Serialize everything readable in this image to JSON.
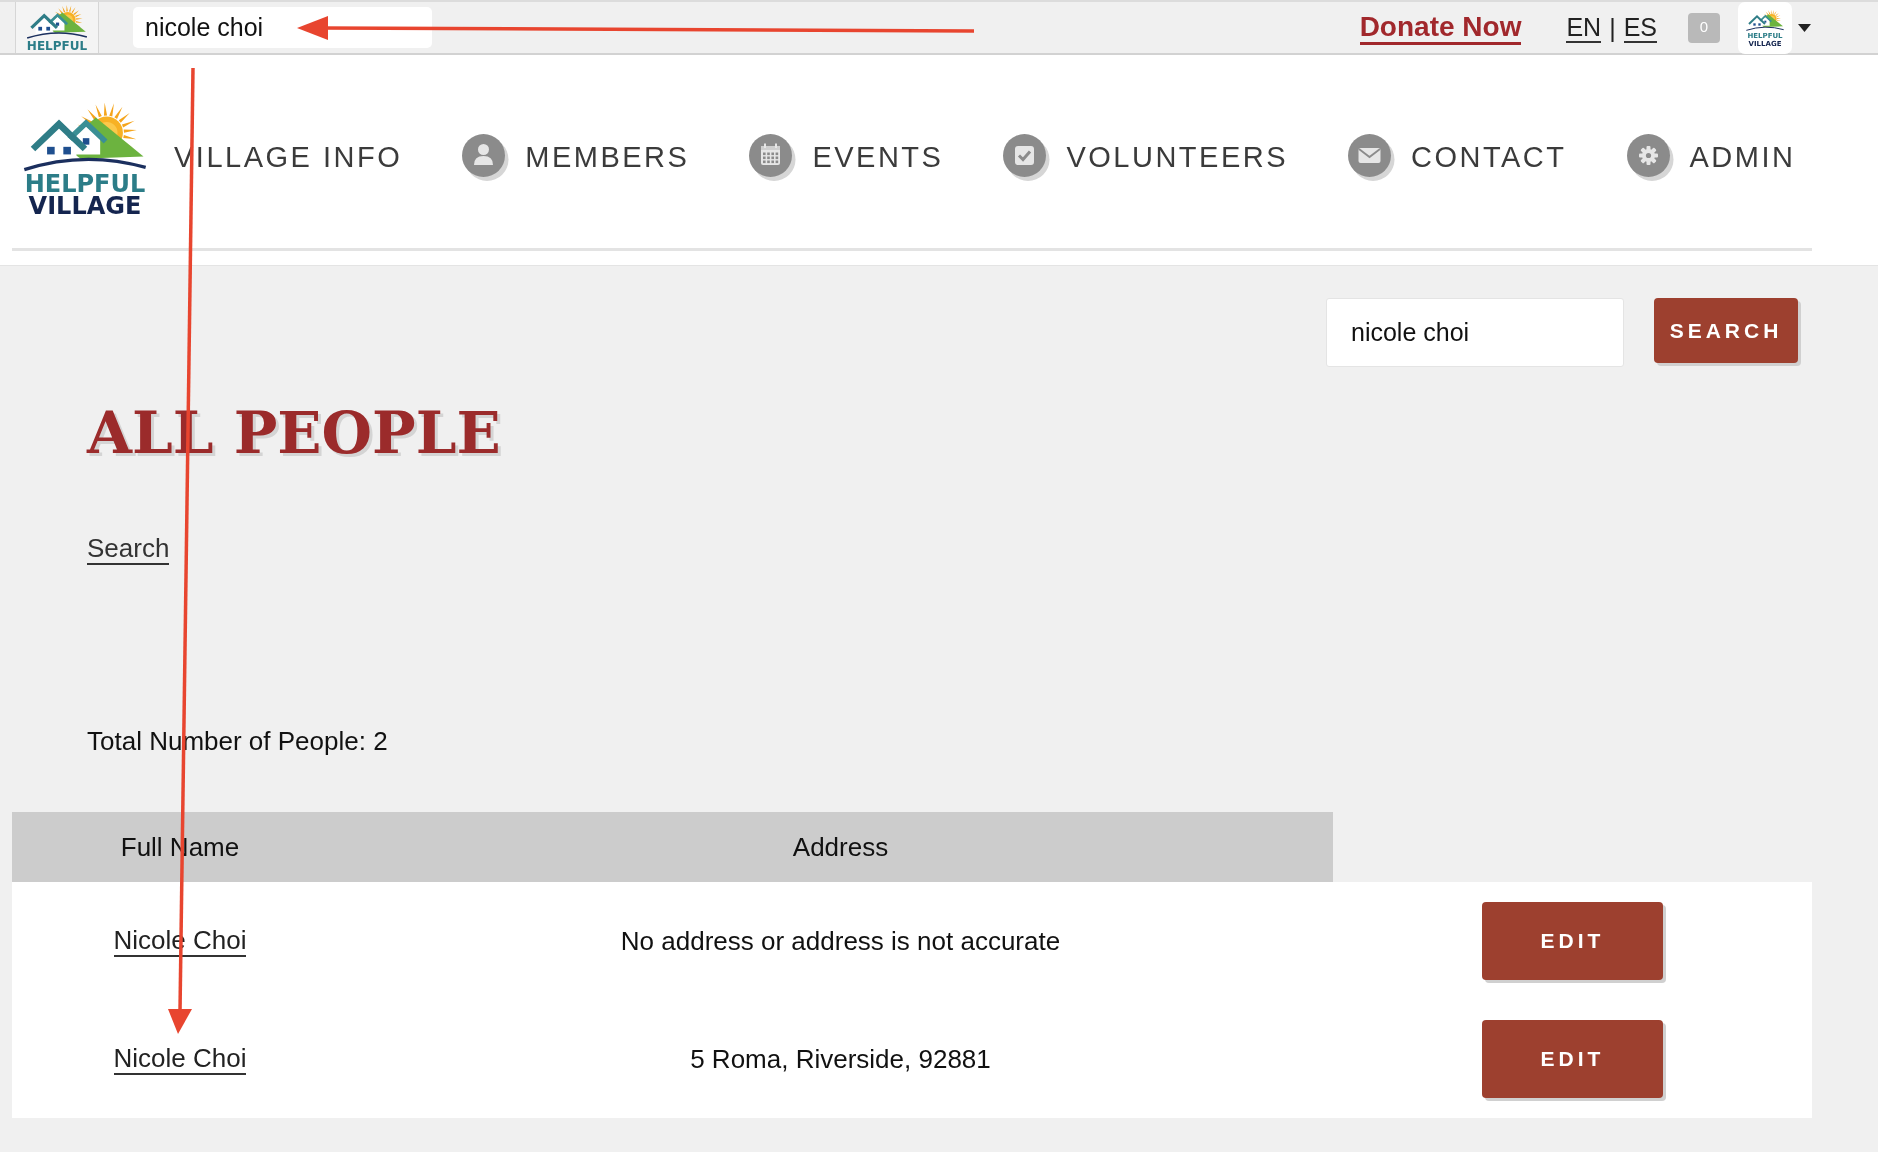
{
  "top_bar": {
    "logo": {
      "lines": [
        "HELPFUL"
      ]
    },
    "search": {
      "value": "nicole choi"
    },
    "donate_link": "Donate Now",
    "languages": [
      "EN",
      "ES"
    ],
    "language_separator": "|",
    "notification_count": "0",
    "account_logo": {
      "lines": [
        "HELPFUL",
        "VILLAGE"
      ]
    }
  },
  "header": {
    "logo": {
      "lines": [
        "HELPFUL",
        "VILLAGE"
      ]
    },
    "nav": [
      {
        "label": "VILLAGE INFO",
        "kind": "plain"
      },
      {
        "label": "MEMBERS",
        "kind": "person"
      },
      {
        "label": "EVENTS",
        "kind": "calendar"
      },
      {
        "label": "VOLUNTEERS",
        "kind": "check"
      },
      {
        "label": "CONTACT",
        "kind": "mail"
      },
      {
        "label": "ADMIN",
        "kind": "gear"
      }
    ]
  },
  "search": {
    "value": "nicole choi",
    "button": "SEARCH"
  },
  "page_title": "ALL PEOPLE",
  "search_link": "Search",
  "total": "Total Number of People: 2",
  "table": {
    "columns": [
      "Full Name",
      "Address"
    ],
    "rows": [
      {
        "full_name": "Nicole Choi",
        "address": "No address or address is not accurate",
        "action": "EDIT"
      },
      {
        "full_name": "Nicole Choi",
        "address": "5 Roma, Riverside, 92881",
        "action": "EDIT"
      }
    ]
  }
}
